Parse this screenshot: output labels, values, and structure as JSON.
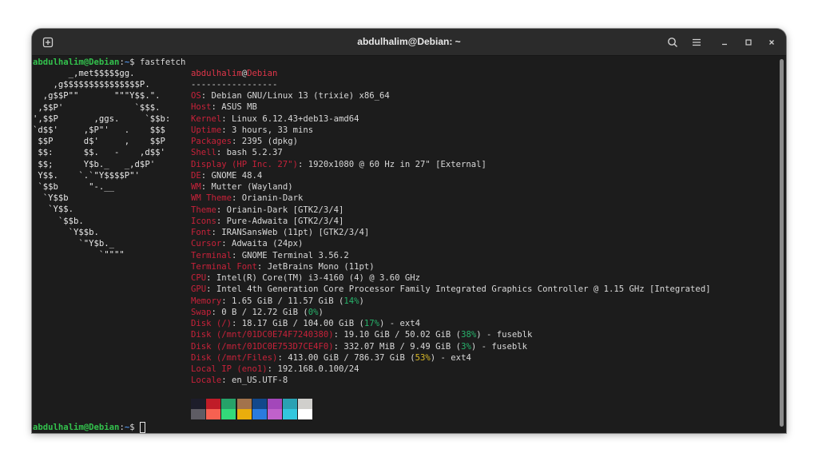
{
  "window": {
    "title": "abdulhalim@Debian: ~"
  },
  "prompt": {
    "user": "abdulhalim@Debian",
    "sep": ":",
    "path": "~",
    "sign": "$",
    "command": "fastfetch"
  },
  "logo_lines": [
    "       _,met$$$$$gg.",
    "    ,g$$$$$$$$$$$$$$$P.",
    "  ,g$$P\"\"       \"\"\"Y$$.\".",
    " ,$$P'              `$$$.",
    "',$$P       ,ggs.     `$$b:",
    "`d$$'     ,$P\"'   .    $$$",
    " $$P      d$'     ,    $$P",
    " $$:      $$.   -    ,d$$'",
    " $$;      Y$b._   _,d$P'",
    " Y$$.    `.`\"Y$$$$P\"'",
    " `$$b      \"-.__",
    "  `Y$$b",
    "   `Y$$.",
    "     `$$b.",
    "       `Y$$b.",
    "         `\"Y$b._",
    "             `\"\"\"\""
  ],
  "header": {
    "user": "abdulhalim",
    "at": "@",
    "host": "Debian",
    "rule": "-----------------"
  },
  "info": [
    {
      "key": "OS",
      "value": "Debian GNU/Linux 13 (trixie) x86_64"
    },
    {
      "key": "Host",
      "value": "ASUS MB"
    },
    {
      "key": "Kernel",
      "value": "Linux 6.12.43+deb13-amd64"
    },
    {
      "key": "Uptime",
      "value": "3 hours, 33 mins"
    },
    {
      "key": "Packages",
      "value": "2395 (dpkg)"
    },
    {
      "key": "Shell",
      "value": "bash 5.2.37"
    },
    {
      "key": "Display (HP Inc. 27\")",
      "value": "1920x1080 @ 60 Hz in 27\" [External]"
    },
    {
      "key": "DE",
      "value": "GNOME 48.4"
    },
    {
      "key": "WM",
      "value": "Mutter (Wayland)"
    },
    {
      "key": "WM Theme",
      "value": "Orianin-Dark"
    },
    {
      "key": "Theme",
      "value": "Orianin-Dark [GTK2/3/4]"
    },
    {
      "key": "Icons",
      "value": "Pure-Adwaita [GTK2/3/4]"
    },
    {
      "key": "Font",
      "value": "IRANSansWeb (11pt) [GTK2/3/4]"
    },
    {
      "key": "Cursor",
      "value": "Adwaita (24px)"
    },
    {
      "key": "Terminal",
      "value": "GNOME Terminal 3.56.2"
    },
    {
      "key": "Terminal Font",
      "value": "JetBrains Mono (11pt)"
    },
    {
      "key": "CPU",
      "value": "Intel(R) Core(TM) i3-4160 (4) @ 3.60 GHz"
    },
    {
      "key": "GPU",
      "value": "Intel 4th Generation Core Processor Family Integrated Graphics Controller @ 1.15 GHz [Integrated]"
    },
    {
      "key": "Memory",
      "value": "1.65 GiB / 11.57 GiB (",
      "pct": "14%",
      "pct_color": "#27b36b",
      "tail": ")"
    },
    {
      "key": "Swap",
      "value": "0 B / 12.72 GiB (",
      "pct": "0%",
      "pct_color": "#27b36b",
      "tail": ")"
    },
    {
      "key": "Disk (/)",
      "value": "18.17 GiB / 104.00 GiB (",
      "pct": "17%",
      "pct_color": "#27b36b",
      "tail": ") - ext4"
    },
    {
      "key": "Disk (/mnt/01DC0E74F7240380)",
      "value": "19.10 GiB / 50.02 GiB (",
      "pct": "38%",
      "pct_color": "#27b36b",
      "tail": ") - fuseblk"
    },
    {
      "key": "Disk (/mnt/01DC0E753D7CE4F0)",
      "value": "332.07 MiB / 9.49 GiB (",
      "pct": "3%",
      "pct_color": "#27b36b",
      "tail": ") - fuseblk"
    },
    {
      "key": "Disk (/mnt/Files)",
      "value": "413.00 GiB / 786.37 GiB (",
      "pct": "53%",
      "pct_color": "#d9b928",
      "tail": ") - ext4"
    },
    {
      "key": "Local IP (eno1)",
      "value": "192.168.0.100/24"
    },
    {
      "key": "Locale",
      "value": "en_US.UTF-8"
    }
  ],
  "palette": {
    "row1": [
      "#1d1d2a",
      "#c01c28",
      "#26a269",
      "#a2734c",
      "#12488b",
      "#a347ba",
      "#2aa1b3",
      "#d0cfcc"
    ],
    "row2": [
      "#5e5c64",
      "#f66151",
      "#33da7a",
      "#e9ad0c",
      "#2a7bde",
      "#c061cb",
      "#33c7de",
      "#ffffff"
    ]
  },
  "colors": {
    "terminal_bg": "#1c1c1c",
    "titlebar": "#2b2b2b",
    "key_red": "#c8223a",
    "prompt_green": "#33c24d",
    "prompt_blue": "#4f8fe0"
  }
}
